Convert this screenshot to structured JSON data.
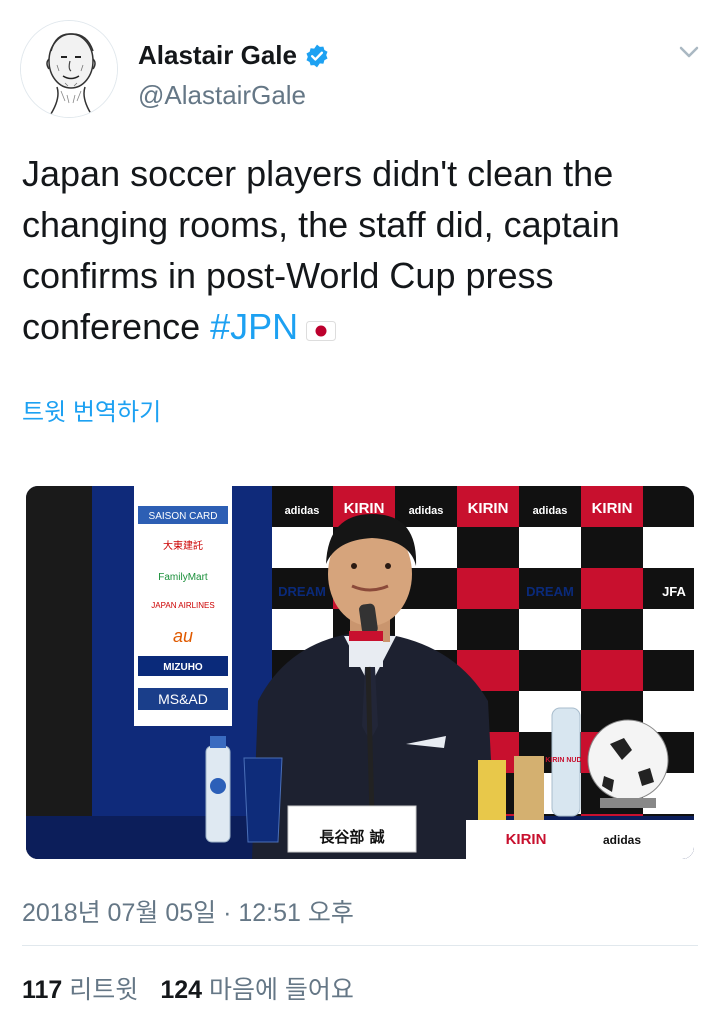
{
  "author": {
    "name": "Alastair Gale",
    "handle": "@AlastairGale",
    "verified": true
  },
  "tweet": {
    "text": "Japan soccer players didn't clean the changing rooms, the staff did, captain confirms in post-World Cup press conference",
    "hashtag": "#JPN",
    "emoji": "japan-flag"
  },
  "translate_label": "트윗 번역하기",
  "media": {
    "nameplate": "長谷部 誠",
    "sponsors_left": [
      "SAISON CARD",
      "大東建託",
      "FamilyMart",
      "JAPAN AIRLINES",
      "au",
      "MIZUHO",
      "MS&AD"
    ],
    "sponsors_board": [
      "adidas",
      "KIRIN",
      "DREAM",
      "JFA"
    ],
    "water_label": "KIRIN NUDA",
    "table_sign": "KIRIN"
  },
  "timestamp": "2018년 07월 05일 · 12:51 오후",
  "stats": {
    "retweets": "117",
    "retweets_label": "리트윗",
    "likes": "124",
    "likes_label": "마음에 들어요"
  },
  "colors": {
    "link": "#1da1f2",
    "secondary_text": "#657786",
    "kirin_red": "#c8102e",
    "backdrop_black": "#111111"
  }
}
